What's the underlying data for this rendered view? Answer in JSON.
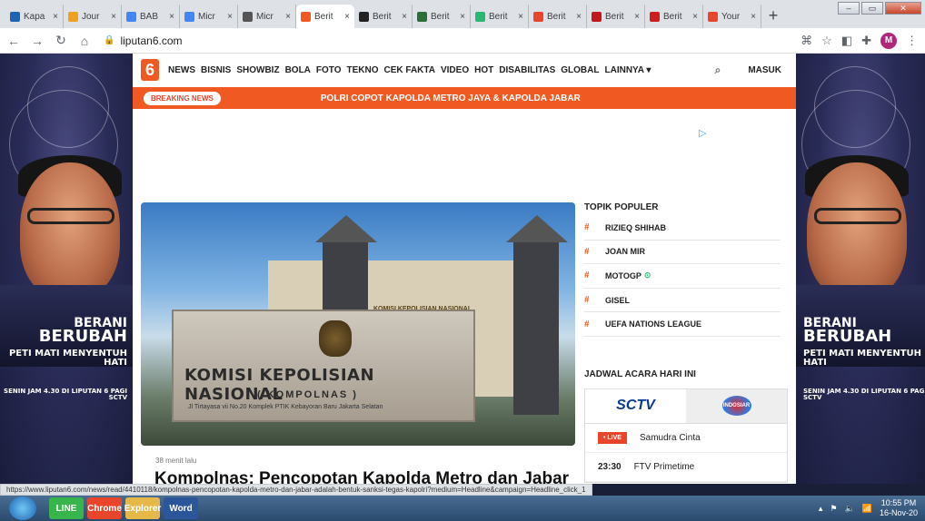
{
  "browser": {
    "tabs": [
      {
        "label": "Kapa",
        "icon": "kompas-favicon",
        "color": "#1e64b4"
      },
      {
        "label": "Jour",
        "icon": "journal-favicon",
        "color": "#f0a020"
      },
      {
        "label": "BAB",
        "icon": "doc-favicon",
        "color": "#4285f4"
      },
      {
        "label": "Micr",
        "icon": "doc-favicon",
        "color": "#4285f4"
      },
      {
        "label": "Micr",
        "icon": "globe-favicon",
        "color": "#555555"
      },
      {
        "label": "Berit",
        "icon": "liputan6-favicon",
        "color": "#f05a22",
        "active": true
      },
      {
        "label": "Berit",
        "icon": "f-favicon",
        "color": "#222222"
      },
      {
        "label": "Berit",
        "icon": "b-favicon",
        "color": "#2a6e3a"
      },
      {
        "label": "Berit",
        "icon": "b-green-favicon",
        "color": "#2bb673"
      },
      {
        "label": "Berit",
        "icon": "suara-favicon",
        "color": "#e8452b"
      },
      {
        "label": "Berit",
        "icon": "m-favicon",
        "color": "#c4161c"
      },
      {
        "label": "Berit",
        "icon": "rcti-favicon",
        "color": "#d01c1c"
      },
      {
        "label": "Your",
        "icon": "youtube-favicon",
        "color": "#e8452b"
      }
    ],
    "tab_close": "×",
    "new_tab": "+",
    "url": "liputan6.com",
    "avatar_letter": "M",
    "status_url": "https://www.liputan6.com/news/read/4410118/kompolnas-pencopotan-kapolda-metro-dan-jabar-adalah-bentuk-sanksi-tegas-kapolri?medium=Headline&campaign=Headline_click_1"
  },
  "site": {
    "logo": "6",
    "nav": [
      "NEWS",
      "BISNIS",
      "SHOWBIZ",
      "BOLA",
      "FOTO",
      "TEKNO",
      "CEK FAKTA",
      "VIDEO",
      "HOT",
      "DISABILITAS",
      "GLOBAL",
      "LAINNYA ▾"
    ],
    "login": "MASUK",
    "breaking_badge": "BREAKING NEWS",
    "breaking_text": "POLRI COPOT KAPOLDA METRO JAYA & KAPOLDA JABAR",
    "ad_marker": "▷",
    "accent": "#f05a22"
  },
  "side_ad": {
    "line1": "BERANI",
    "line2": "BERUBAH",
    "line3": "PETI MATI MENYENTUH HATI",
    "line4": "SENIN JAM 4.30 DI LIPUTAN 6 PAGI SCTV"
  },
  "article": {
    "time_ago": "38 menit lalu",
    "headline": "Kompolnas: Pencopotan Kapolda Metro dan Jabar",
    "photo_sign_1": "KOMISI KEPOLISIAN NASIONAL",
    "photo_sign_2": "( KOMPOLNAS )",
    "photo_sign_3": "Jl Tirtayasa vii No.20 Komplek PTIK Kebayoran Baru Jakarta Selatan",
    "photo_building": "KOMISI KEPOLISIAN NASIONAL"
  },
  "sidebar": {
    "topik_title": "TOPIK POPULER",
    "topik": [
      {
        "name": "RIZIEQ SHIHAB"
      },
      {
        "name": "JOAN MIR"
      },
      {
        "name": "MOTOGP",
        "verified": true
      },
      {
        "name": "GISEL"
      },
      {
        "name": "UEFA NATIONS LEAGUE"
      }
    ],
    "hash": "#",
    "jadwal_title": "JADWAL ACARA HARI INI",
    "channel_1": "SCTV",
    "channel_2": "INDOSIAR",
    "programs": [
      {
        "tag": "• LIVE",
        "title": "Samudra Cinta"
      },
      {
        "time": "23:30",
        "title": "FTV Primetime"
      }
    ]
  },
  "taskbar": {
    "time": "10:55 PM",
    "date": "16-Nov-20",
    "apps": [
      "LINE",
      "Chrome",
      "Explorer",
      "Word"
    ]
  }
}
